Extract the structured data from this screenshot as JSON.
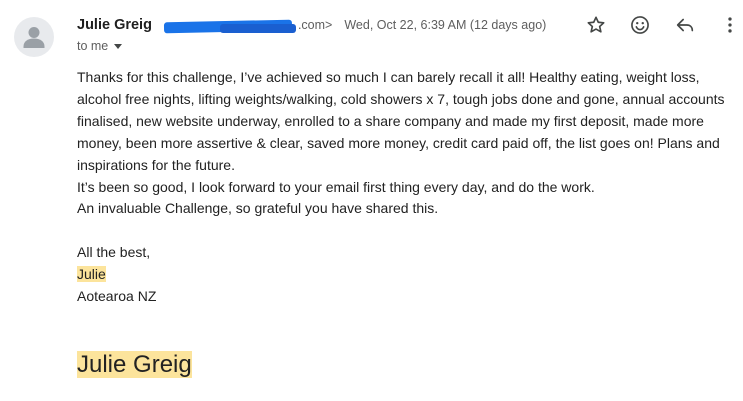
{
  "sender": {
    "name": "Julie Greig",
    "email_visible_suffix": ".com>"
  },
  "datetime": "Wed, Oct 22, 6:39 AM (12 days ago)",
  "recipient": "to me",
  "icons": {
    "star": "star-outline-icon",
    "emoji": "emoji-reaction-icon",
    "reply": "reply-icon",
    "more": "more-vert-icon"
  },
  "message": {
    "paragraph1": "Thanks for this challenge, I’ve achieved so much I can barely recall it all! Healthy eating, weight loss, alcohol free nights, lifting weights/walking, cold showers x 7, tough jobs done and gone, annual accounts finalised, new website underway, enrolled to a share company and made my first deposit, made more money, been more assertive & clear, saved more money, credit card paid off, the list goes on! Plans and inspirations for the future.",
    "paragraph2": "It’s been so good, I look forward to your email first thing every day, and do the work.",
    "paragraph3": "An invaluable Challenge, so grateful you have shared this.",
    "closing": "All the best,",
    "first_name": "Julie",
    "location": "Aotearoa NZ"
  },
  "signature": "Julie Greig",
  "colors": {
    "highlight": "#fce49c",
    "redaction": "#1a73e8",
    "secondary_text": "#5e5e5e"
  }
}
